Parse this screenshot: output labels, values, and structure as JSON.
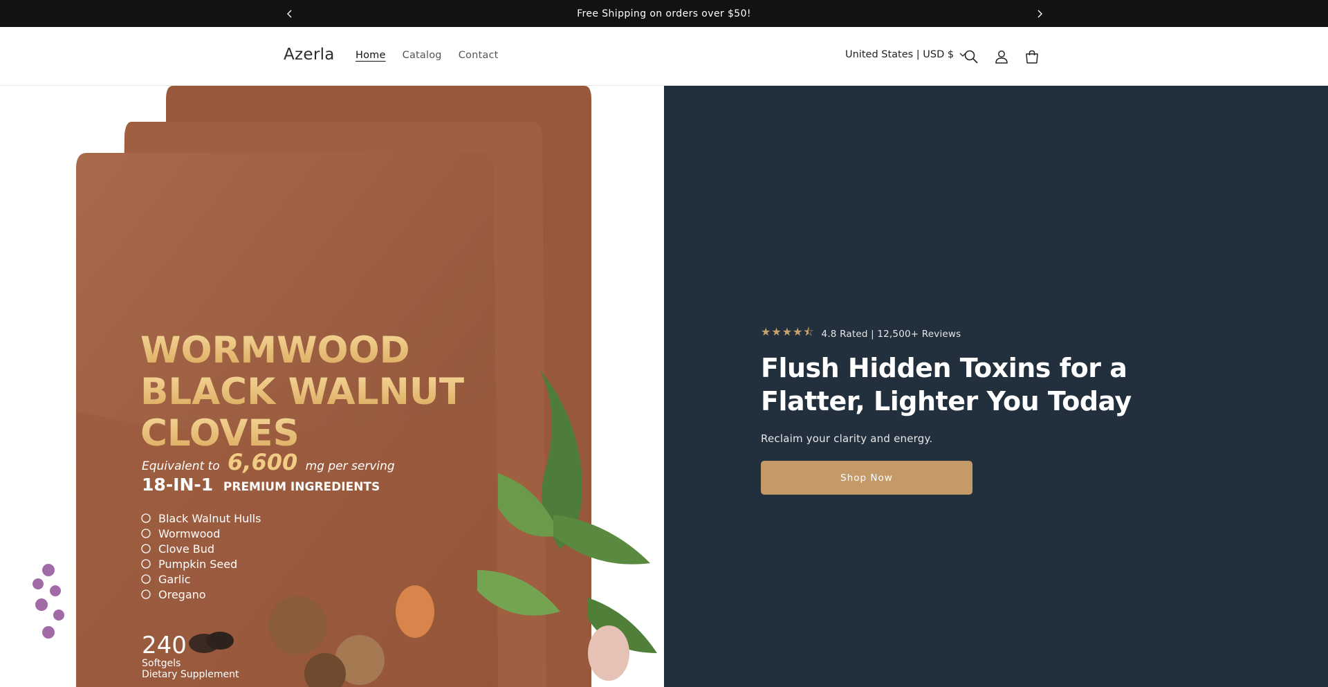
{
  "announcement": {
    "message": "Free Shipping on orders over $50!"
  },
  "header": {
    "logo": "Azerla",
    "nav": [
      {
        "label": "Home",
        "active": true
      },
      {
        "label": "Catalog",
        "active": false
      },
      {
        "label": "Contact",
        "active": false
      }
    ],
    "locale": "United States | USD $",
    "icons": [
      "search-icon",
      "account-icon",
      "cart-icon"
    ]
  },
  "hero": {
    "stars": "★★★★⯪",
    "rating_text": "4.8 Rated | 12,500+ Reviews",
    "title": "Flush Hidden Toxins for a Flatter, Lighter You Today",
    "subtitle": "Reclaim your clarity and energy.",
    "cta_label": "Shop Now",
    "colors": {
      "panel": "#222f3d",
      "cta": "#c49a68",
      "stars": "#c8a26c"
    }
  },
  "product": {
    "title_lines": [
      "WORMWOOD",
      "BLACK WALNUT",
      "CLOVES"
    ],
    "equivalent_prefix": "Equivalent to",
    "equivalent_amount": "6,600",
    "equivalent_suffix": "mg per serving",
    "ingredients_count": "18-IN-1",
    "ingredients_label": "PREMIUM INGREDIENTS",
    "ingredients": [
      "Black Walnut Hulls",
      "Wormwood",
      "Clove Bud",
      "Pumpkin Seed",
      "Garlic",
      "Oregano"
    ],
    "count": "240",
    "count_unit": "Softgels",
    "count_label": "Dietary Supplement"
  }
}
